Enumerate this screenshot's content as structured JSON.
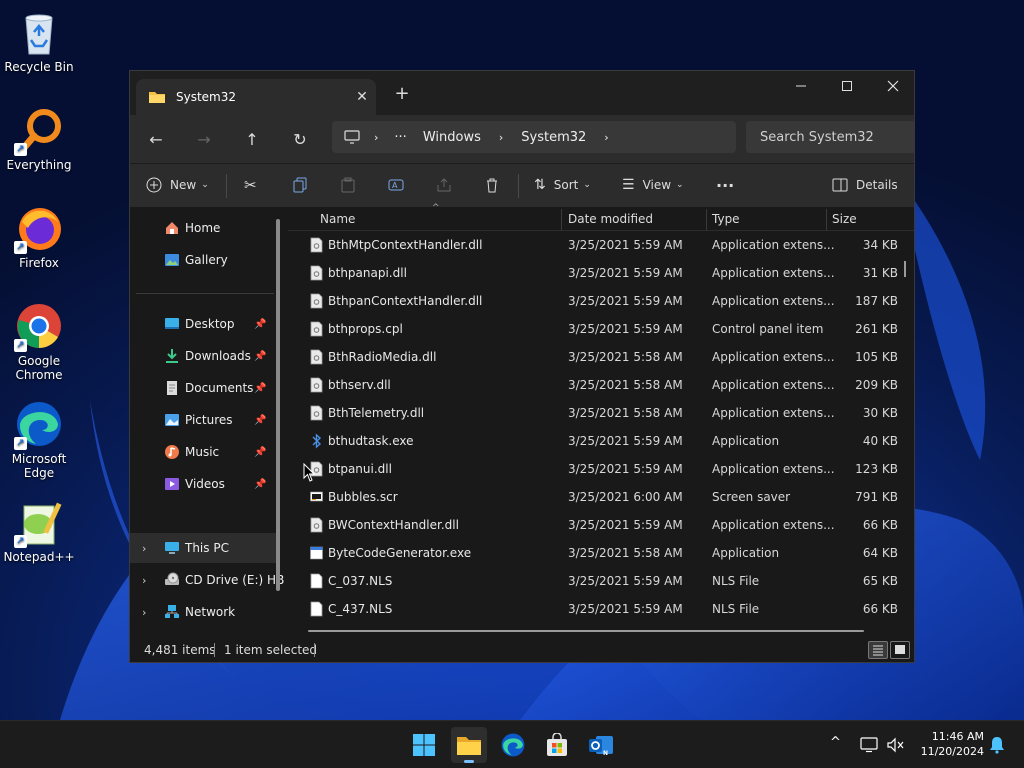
{
  "desktop": {
    "icons": [
      {
        "label": "Recycle Bin"
      },
      {
        "label": "Everything"
      },
      {
        "label": "Firefox"
      },
      {
        "label": "Google Chrome"
      },
      {
        "label": "Microsoft Edge"
      },
      {
        "label": "Notepad++"
      }
    ]
  },
  "window": {
    "tab_title": "System32",
    "breadcrumb": [
      "Windows",
      "System32"
    ],
    "search_placeholder": "Search System32",
    "toolbar": {
      "new_label": "New",
      "sort_label": "Sort",
      "view_label": "View",
      "details_label": "Details"
    },
    "nav": {
      "home": "Home",
      "gallery": "Gallery",
      "desktop": "Desktop",
      "downloads": "Downloads",
      "documents": "Documents",
      "pictures": "Pictures",
      "music": "Music",
      "videos": "Videos",
      "this_pc": "This PC",
      "cd_drive": "CD Drive (E:) HB",
      "network": "Network"
    },
    "columns": {
      "name": "Name",
      "date": "Date modified",
      "type": "Type",
      "size": "Size"
    },
    "files": [
      {
        "name": "BthMtpContextHandler.dll",
        "date": "3/25/2021 5:59 AM",
        "type": "Application extens...",
        "size": "34 KB",
        "icon": "dll"
      },
      {
        "name": "bthpanapi.dll",
        "date": "3/25/2021 5:59 AM",
        "type": "Application extens...",
        "size": "31 KB",
        "icon": "dll"
      },
      {
        "name": "BthpanContextHandler.dll",
        "date": "3/25/2021 5:59 AM",
        "type": "Application extens...",
        "size": "187 KB",
        "icon": "dll"
      },
      {
        "name": "bthprops.cpl",
        "date": "3/25/2021 5:59 AM",
        "type": "Control panel item",
        "size": "261 KB",
        "icon": "dll"
      },
      {
        "name": "BthRadioMedia.dll",
        "date": "3/25/2021 5:58 AM",
        "type": "Application extens...",
        "size": "105 KB",
        "icon": "dll"
      },
      {
        "name": "bthserv.dll",
        "date": "3/25/2021 5:58 AM",
        "type": "Application extens...",
        "size": "209 KB",
        "icon": "dll"
      },
      {
        "name": "BthTelemetry.dll",
        "date": "3/25/2021 5:58 AM",
        "type": "Application extens...",
        "size": "30 KB",
        "icon": "dll"
      },
      {
        "name": "bthudtask.exe",
        "date": "3/25/2021 5:59 AM",
        "type": "Application",
        "size": "40 KB",
        "icon": "bluetooth"
      },
      {
        "name": "btpanui.dll",
        "date": "3/25/2021 5:59 AM",
        "type": "Application extens...",
        "size": "123 KB",
        "icon": "dll"
      },
      {
        "name": "Bubbles.scr",
        "date": "3/25/2021 6:00 AM",
        "type": "Screen saver",
        "size": "791 KB",
        "icon": "scr"
      },
      {
        "name": "BWContextHandler.dll",
        "date": "3/25/2021 5:59 AM",
        "type": "Application extens...",
        "size": "66 KB",
        "icon": "dll"
      },
      {
        "name": "ByteCodeGenerator.exe",
        "date": "3/25/2021 5:58 AM",
        "type": "Application",
        "size": "64 KB",
        "icon": "exe"
      },
      {
        "name": "C_037.NLS",
        "date": "3/25/2021 5:59 AM",
        "type": "NLS File",
        "size": "65 KB",
        "icon": "file"
      },
      {
        "name": "C_437.NLS",
        "date": "3/25/2021 5:59 AM",
        "type": "NLS File",
        "size": "66 KB",
        "icon": "file"
      }
    ],
    "status": {
      "items": "4,481 items",
      "selected": "1 item selected"
    }
  },
  "taskbar": {
    "time": "11:46 AM",
    "date": "11/20/2024"
  },
  "colors": {
    "accent": "#0078d4",
    "folder": "#f5c245",
    "window_bg": "#191919",
    "toolbar_bg": "#2c2c2c"
  }
}
